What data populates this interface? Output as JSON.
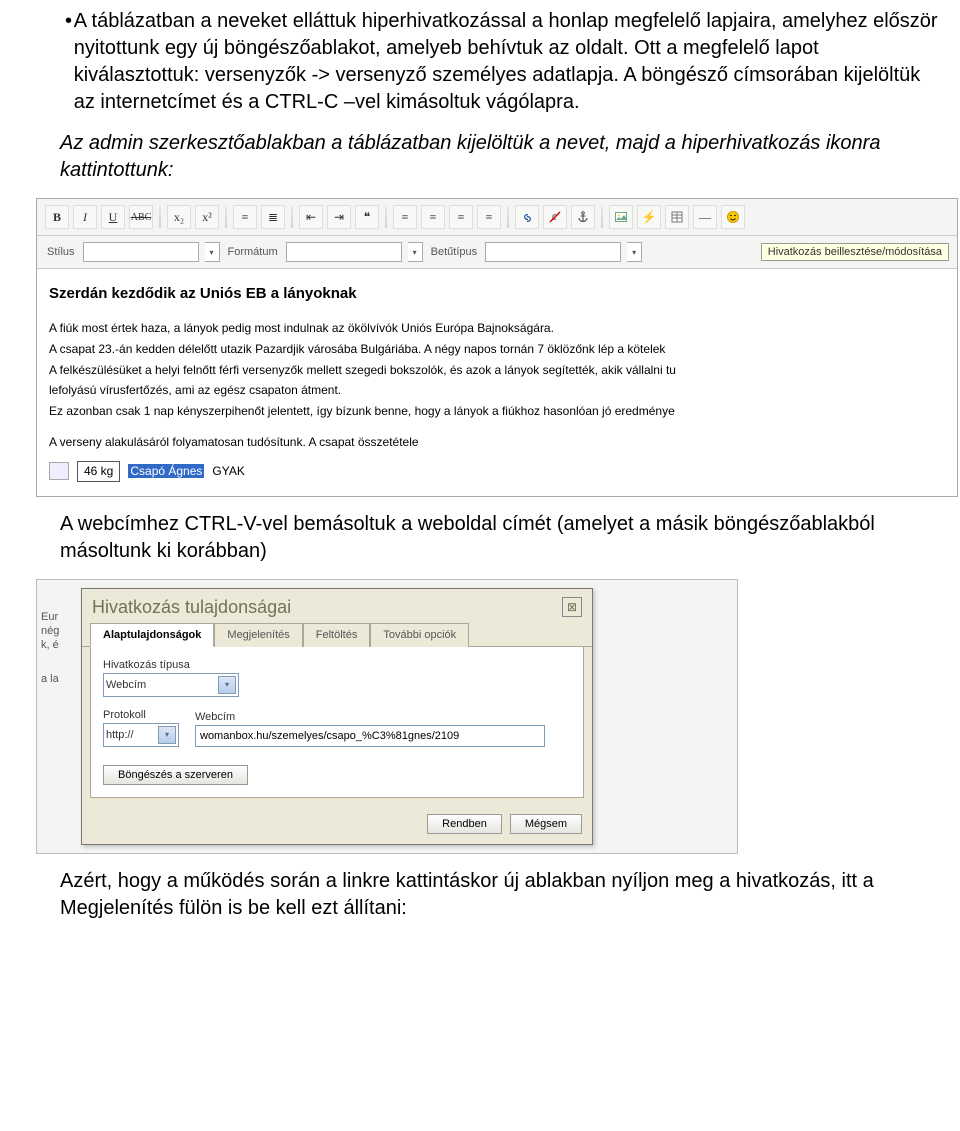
{
  "intro": {
    "bullet_text": "A táblázatban a neveket elláttuk hiperhivatkozással a honlap megfelelő lapjaira, amelyhez először nyitottunk egy új böngészőablakot, amelyeb behívtuk az oldalt. Ott a megfelelő lapot kiválasztottuk: versenyzők -> versenyző személyes adatlapja. A böngésző címsorában kijelöltük az internetcímet és a CTRL-C –vel kimásoltuk vágólapra.",
    "admin_note": "Az admin szerkesztőablakban a táblázatban kijelöltük a nevet, majd a hiperhivatkozás ikonra kattintottunk:"
  },
  "editor_toolbar": {
    "bold": "B",
    "italic": "I",
    "underline": "U",
    "strike": "ABC",
    "sub": "x₂",
    "sup": "x²",
    "style_label": "Stílus",
    "format_label": "Formátum",
    "font_label": "Betűtípus",
    "tooltip": "Hivatkozás beillesztése/módosítása"
  },
  "editor_content": {
    "heading": "Szerdán kezdődik az Uniós EB a lányoknak",
    "p1": "A fiúk most értek haza, a lányok pedig most indulnak az ökölvívók Uniós Európa Bajnokságára.",
    "p2": "A csapat 23.-án kedden délelőtt utazik Pazardjik városába Bulgáriába. A négy napos tornán 7 öklözőnk lép a kötelek",
    "p3": "A felkészülésüket a helyi felnőtt férfi versenyzők mellett szegedi bokszolók, és azok a lányok segítették, akik vállalni tu",
    "p4": "lefolyású vírusfertőzés, ami az egész csapaton átment.",
    "p5": "Ez azonban csak 1 nap kényszerpihenőt jelentett, így bízunk benne, hogy a lányok a fiúkhoz hasonlóan jó eredménye",
    "p6": "A verseny alakulásáról folyamatosan tudósítunk. A csapat összetétele",
    "weight": "46 kg",
    "selected_name": "Csapó Ágnes",
    "after_name": "GYAK"
  },
  "mid_text": "A webcímhez CTRL-V-vel bemásoltuk a weboldal címét (amelyet a másik böngészőablakból másoltunk ki korábban)",
  "bg_fragments": {
    "l1": "Eur",
    "l2": "nég",
    "l3": "k, é",
    "l4": "a la"
  },
  "dialog": {
    "title": "Hivatkozás tulajdonságai",
    "tabs": {
      "basic": "Alaptulajdonságok",
      "display": "Megjelenítés",
      "upload": "Feltöltés",
      "more": "További opciók"
    },
    "link_type_label": "Hivatkozás típusa",
    "link_type_value": "Webcím",
    "protocol_label": "Protokoll",
    "protocol_value": "http://",
    "url_label": "Webcím",
    "url_value": "womanbox.hu/szemelyes/csapo_%C3%81gnes/2109",
    "browse_btn": "Böngészés a szerveren",
    "ok_btn": "Rendben",
    "cancel_btn": "Mégsem"
  },
  "outro": "Azért, hogy a működés során a linkre kattintáskor új ablakban nyíljon meg a hivatkozás, itt a Megjelenítés fülön is be kell ezt állítani:"
}
